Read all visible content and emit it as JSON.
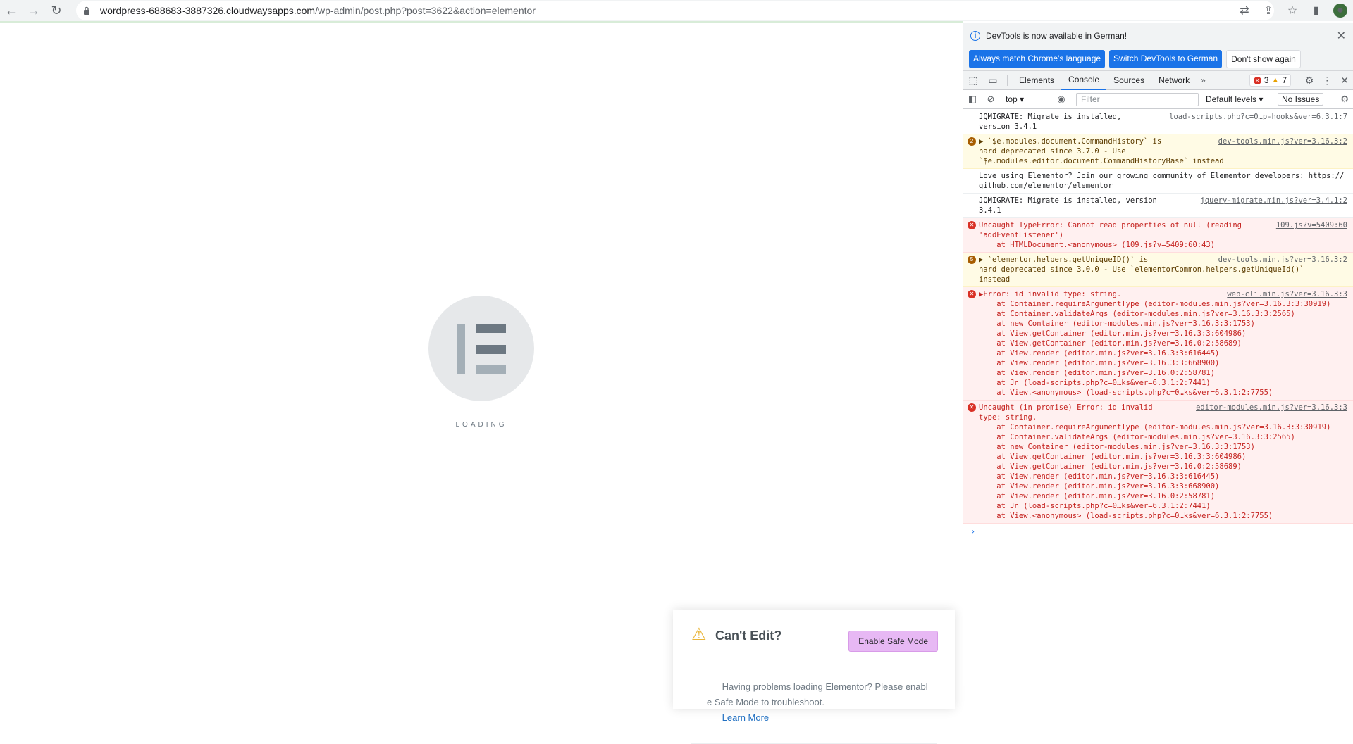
{
  "browser": {
    "url_host": "wordpress-688683-3887326.cloudwaysapps.com",
    "url_path": "/wp-admin/post.php?post=3622&action=elementor"
  },
  "page": {
    "loading_text": "LOADING",
    "cant_edit": {
      "title": "Can't Edit?",
      "safe_mode_button": "Enable Safe Mode",
      "message": "Having problems loading Elementor? Please enable Safe Mode to troubleshoot.",
      "learn_more": "Learn More"
    }
  },
  "devtools": {
    "infobar": {
      "text": "DevTools is now available in German!",
      "btn_match": "Always match Chrome's language",
      "btn_switch": "Switch DevTools to German",
      "btn_dont_show": "Don't show again"
    },
    "tabs": [
      "Elements",
      "Console",
      "Sources",
      "Network"
    ],
    "active_tab": "Console",
    "error_count": "3",
    "warning_count": "7",
    "toolbar": {
      "context": "top",
      "filter_placeholder": "Filter",
      "levels": "Default levels",
      "issues": "No Issues"
    },
    "messages": [
      {
        "type": "log",
        "text": "JQMIGRATE: Migrate is installed,\nversion 3.4.1",
        "src": "load-scripts.php?c=0…p-hooks&ver=6.3.1:7"
      },
      {
        "type": "warn",
        "badge": "2",
        "text": "▶ `$e.modules.document.CommandHistory` is\nhard deprecated since 3.7.0 - Use\n`$e.modules.editor.document.CommandHistoryBase` instead",
        "src": "dev-tools.min.js?ver=3.16.3:2"
      },
      {
        "type": "log",
        "text": "Love using Elementor? Join our growing community of Elementor developers: https://github.com/elementor/elementor",
        "src": ""
      },
      {
        "type": "log",
        "text": "JQMIGRATE: Migrate is installed, version\n3.4.1",
        "src": "jquery-migrate.min.js?ver=3.4.1:2"
      },
      {
        "type": "error",
        "text": "Uncaught TypeError: Cannot read properties of null (reading\n'addEventListener')\n    at HTMLDocument.<anonymous> (109.js?v=5409:60:43)",
        "src": "109.js?v=5409:60"
      },
      {
        "type": "warn",
        "badge": "5",
        "text": "▶ `elementor.helpers.getUniqueID()` is\nhard deprecated since 3.0.0 - Use `elementorCommon.helpers.getUniqueId()`\ninstead",
        "src": "dev-tools.min.js?ver=3.16.3:2"
      },
      {
        "type": "error",
        "text": "▶Error: id invalid type: string.\n    at Container.requireArgumentType (editor-modules.min.js?ver=3.16.3:3:30919)\n    at Container.validateArgs (editor-modules.min.js?ver=3.16.3:3:2565)\n    at new Container (editor-modules.min.js?ver=3.16.3:3:1753)\n    at View.getContainer (editor.min.js?ver=3.16.3:3:604986)\n    at View.getContainer (editor.min.js?ver=3.16.0:2:58689)\n    at View.render (editor.min.js?ver=3.16.3:3:616445)\n    at View.render (editor.min.js?ver=3.16.3:3:668900)\n    at View.render (editor.min.js?ver=3.16.0:2:58781)\n    at Jn (load-scripts.php?c=0…ks&ver=6.3.1:2:7441)\n    at View.<anonymous> (load-scripts.php?c=0…ks&ver=6.3.1:2:7755)",
        "src": "web-cli.min.js?ver=3.16.3:3"
      },
      {
        "type": "error",
        "text": "Uncaught (in promise) Error: id invalid\ntype: string.\n    at Container.requireArgumentType (editor-modules.min.js?ver=3.16.3:3:30919)\n    at Container.validateArgs (editor-modules.min.js?ver=3.16.3:3:2565)\n    at new Container (editor-modules.min.js?ver=3.16.3:3:1753)\n    at View.getContainer (editor.min.js?ver=3.16.3:3:604986)\n    at View.getContainer (editor.min.js?ver=3.16.0:2:58689)\n    at View.render (editor.min.js?ver=3.16.3:3:616445)\n    at View.render (editor.min.js?ver=3.16.3:3:668900)\n    at View.render (editor.min.js?ver=3.16.0:2:58781)\n    at Jn (load-scripts.php?c=0…ks&ver=6.3.1:2:7441)\n    at View.<anonymous> (load-scripts.php?c=0…ks&ver=6.3.1:2:7755)",
        "src": "editor-modules.min.js?ver=3.16.3:3"
      }
    ],
    "prompt": "›"
  }
}
